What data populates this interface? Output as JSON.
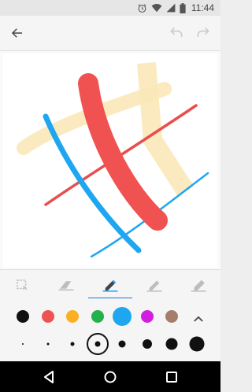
{
  "status_bar": {
    "time": "11:44",
    "icons": [
      "alarm-icon",
      "wifi-icon",
      "signal-icon",
      "battery-icon"
    ]
  },
  "toolbar": {
    "back_icon": "arrow-left-icon",
    "undo_icon": "undo-icon",
    "redo_icon": "redo-icon"
  },
  "drawing_tools": [
    {
      "name": "select",
      "icon": "lasso-select-icon",
      "selected": false
    },
    {
      "name": "eraser",
      "icon": "eraser-icon",
      "selected": false
    },
    {
      "name": "pen",
      "icon": "pen-icon",
      "selected": true
    },
    {
      "name": "marker",
      "icon": "marker-icon",
      "selected": false
    },
    {
      "name": "highlighter",
      "icon": "highlighter-icon",
      "selected": false
    }
  ],
  "colors": [
    {
      "name": "black",
      "hex": "#111111",
      "selected": false
    },
    {
      "name": "red",
      "hex": "#f05252",
      "selected": false
    },
    {
      "name": "yellow",
      "hex": "#fbb022",
      "selected": false
    },
    {
      "name": "green",
      "hex": "#22b14c",
      "selected": false
    },
    {
      "name": "blue",
      "hex": "#1ea7f0",
      "selected": true
    },
    {
      "name": "purple",
      "hex": "#d31ee0",
      "selected": false
    },
    {
      "name": "brown",
      "hex": "#a67c6a",
      "selected": false
    }
  ],
  "brush_sizes": [
    1,
    2,
    3,
    4,
    5,
    6,
    7,
    8
  ],
  "selected_brush_size": 4,
  "canvas_strokes": [
    {
      "color": "#fbe8b8",
      "kind": "highlighter"
    },
    {
      "color": "#fbe8b8",
      "kind": "highlighter"
    },
    {
      "color": "#e94e4e",
      "kind": "pen"
    },
    {
      "color": "#1ea7f0",
      "kind": "pen"
    },
    {
      "color": "#1ea7f0",
      "kind": "pen"
    },
    {
      "color": "#f05252",
      "kind": "marker"
    }
  ],
  "nav_bar": {
    "back_icon": "nav-back-icon",
    "home_icon": "nav-home-icon",
    "recents_icon": "nav-recents-icon"
  }
}
